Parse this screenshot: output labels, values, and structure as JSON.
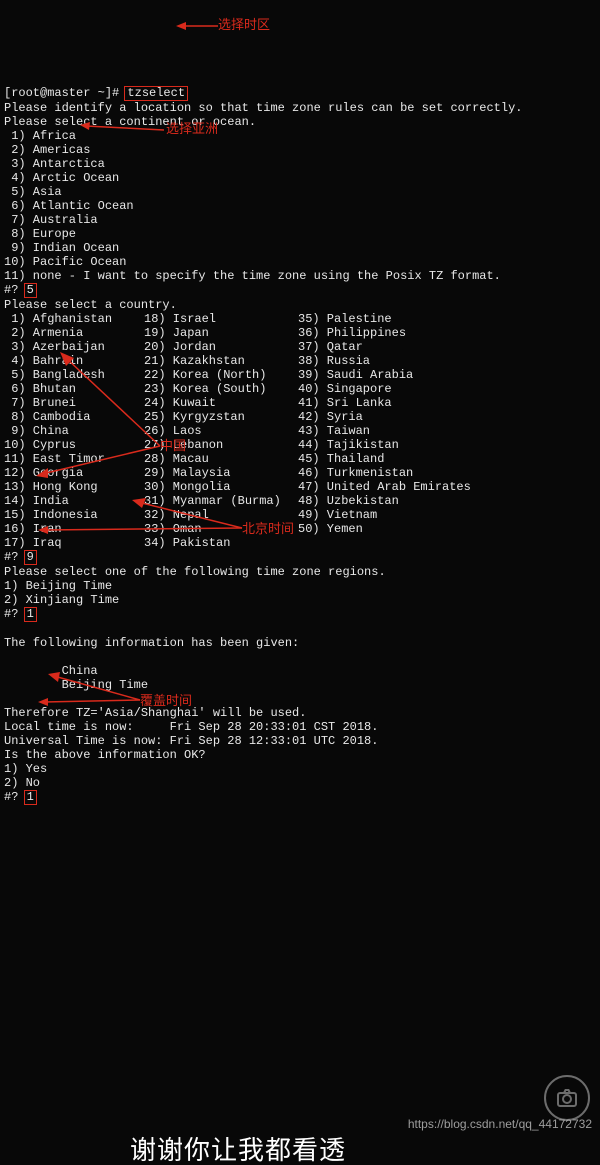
{
  "prompt": "[root@master ~]#",
  "command": "tzselect",
  "intro1": "Please identify a location so that time zone rules can be set correctly.",
  "intro2": "Please select a continent or ocean.",
  "continents": [
    " 1) Africa",
    " 2) Americas",
    " 3) Antarctica",
    " 4) Arctic Ocean",
    " 5) Asia",
    " 6) Atlantic Ocean",
    " 7) Australia",
    " 8) Europe",
    " 9) Indian Ocean",
    "10) Pacific Ocean",
    "11) none - I want to specify the time zone using the Posix TZ format."
  ],
  "ask": "#?",
  "ans1": "5",
  "countries_header": "Please select a country.",
  "countries": [
    [
      " 1) Afghanistan",
      "18) Israel",
      "35) Palestine"
    ],
    [
      " 2) Armenia",
      "19) Japan",
      "36) Philippines"
    ],
    [
      " 3) Azerbaijan",
      "20) Jordan",
      "37) Qatar"
    ],
    [
      " 4) Bahrain",
      "21) Kazakhstan",
      "38) Russia"
    ],
    [
      " 5) Bangladesh",
      "22) Korea (North)",
      "39) Saudi Arabia"
    ],
    [
      " 6) Bhutan",
      "23) Korea (South)",
      "40) Singapore"
    ],
    [
      " 7) Brunei",
      "24) Kuwait",
      "41) Sri Lanka"
    ],
    [
      " 8) Cambodia",
      "25) Kyrgyzstan",
      "42) Syria"
    ],
    [
      " 9) China",
      "26) Laos",
      "43) Taiwan"
    ],
    [
      "10) Cyprus",
      "27) Lebanon",
      "44) Tajikistan"
    ],
    [
      "11) East Timor",
      "28) Macau",
      "45) Thailand"
    ],
    [
      "12) Georgia",
      "29) Malaysia",
      "46) Turkmenistan"
    ],
    [
      "13) Hong Kong",
      "30) Mongolia",
      "47) United Arab Emirates"
    ],
    [
      "14) India",
      "31) Myanmar (Burma)",
      "48) Uzbekistan"
    ],
    [
      "15) Indonesia",
      "32) Nepal",
      "49) Vietnam"
    ],
    [
      "16) Iran",
      "33) Oman",
      "50) Yemen"
    ],
    [
      "17) Iraq",
      "34) Pakistan",
      ""
    ]
  ],
  "ans2": "9",
  "regions_header": "Please select one of the following time zone regions.",
  "regions": [
    "1) Beijing Time",
    "2) Xinjiang Time"
  ],
  "ans3": "1",
  "info1": "The following information has been given:",
  "info_country": "        China",
  "info_tz": "        Beijing Time",
  "therefore": "Therefore TZ='Asia/Shanghai' will be used.",
  "local": "Local time is now:     Fri Sep 28 20:33:01 CST 2018.",
  "utc": "Universal Time is now: Fri Sep 28 12:33:01 UTC 2018.",
  "isok": "Is the above information OK?",
  "yesno": [
    "1) Yes",
    "2) No"
  ],
  "ans4": "1",
  "anno": {
    "tz": "选择时区",
    "asia": "选择亚洲",
    "china": "中国",
    "bj": "北京时间",
    "cover": "覆盖时间"
  },
  "watermark": "https://blog.csdn.net/qq_44172732",
  "bottom_text": "谢谢你让我都看透"
}
